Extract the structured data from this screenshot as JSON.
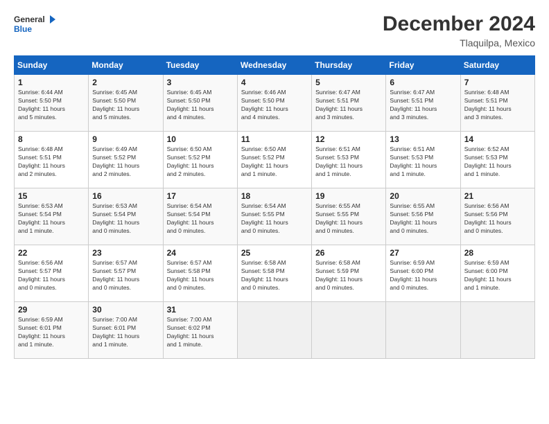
{
  "header": {
    "logo_general": "General",
    "logo_blue": "Blue",
    "month_title": "December 2024",
    "location": "Tlaquilpa, Mexico"
  },
  "calendar": {
    "days_of_week": [
      "Sunday",
      "Monday",
      "Tuesday",
      "Wednesday",
      "Thursday",
      "Friday",
      "Saturday"
    ],
    "weeks": [
      [
        {
          "day": "",
          "info": ""
        },
        {
          "day": "2",
          "info": "Sunrise: 6:45 AM\nSunset: 5:50 PM\nDaylight: 11 hours\nand 5 minutes."
        },
        {
          "day": "3",
          "info": "Sunrise: 6:45 AM\nSunset: 5:50 PM\nDaylight: 11 hours\nand 4 minutes."
        },
        {
          "day": "4",
          "info": "Sunrise: 6:46 AM\nSunset: 5:50 PM\nDaylight: 11 hours\nand 4 minutes."
        },
        {
          "day": "5",
          "info": "Sunrise: 6:47 AM\nSunset: 5:51 PM\nDaylight: 11 hours\nand 3 minutes."
        },
        {
          "day": "6",
          "info": "Sunrise: 6:47 AM\nSunset: 5:51 PM\nDaylight: 11 hours\nand 3 minutes."
        },
        {
          "day": "7",
          "info": "Sunrise: 6:48 AM\nSunset: 5:51 PM\nDaylight: 11 hours\nand 3 minutes."
        }
      ],
      [
        {
          "day": "8",
          "info": "Sunrise: 6:48 AM\nSunset: 5:51 PM\nDaylight: 11 hours\nand 2 minutes."
        },
        {
          "day": "9",
          "info": "Sunrise: 6:49 AM\nSunset: 5:52 PM\nDaylight: 11 hours\nand 2 minutes."
        },
        {
          "day": "10",
          "info": "Sunrise: 6:50 AM\nSunset: 5:52 PM\nDaylight: 11 hours\nand 2 minutes."
        },
        {
          "day": "11",
          "info": "Sunrise: 6:50 AM\nSunset: 5:52 PM\nDaylight: 11 hours\nand 1 minute."
        },
        {
          "day": "12",
          "info": "Sunrise: 6:51 AM\nSunset: 5:53 PM\nDaylight: 11 hours\nand 1 minute."
        },
        {
          "day": "13",
          "info": "Sunrise: 6:51 AM\nSunset: 5:53 PM\nDaylight: 11 hours\nand 1 minute."
        },
        {
          "day": "14",
          "info": "Sunrise: 6:52 AM\nSunset: 5:53 PM\nDaylight: 11 hours\nand 1 minute."
        }
      ],
      [
        {
          "day": "15",
          "info": "Sunrise: 6:53 AM\nSunset: 5:54 PM\nDaylight: 11 hours\nand 1 minute."
        },
        {
          "day": "16",
          "info": "Sunrise: 6:53 AM\nSunset: 5:54 PM\nDaylight: 11 hours\nand 0 minutes."
        },
        {
          "day": "17",
          "info": "Sunrise: 6:54 AM\nSunset: 5:54 PM\nDaylight: 11 hours\nand 0 minutes."
        },
        {
          "day": "18",
          "info": "Sunrise: 6:54 AM\nSunset: 5:55 PM\nDaylight: 11 hours\nand 0 minutes."
        },
        {
          "day": "19",
          "info": "Sunrise: 6:55 AM\nSunset: 5:55 PM\nDaylight: 11 hours\nand 0 minutes."
        },
        {
          "day": "20",
          "info": "Sunrise: 6:55 AM\nSunset: 5:56 PM\nDaylight: 11 hours\nand 0 minutes."
        },
        {
          "day": "21",
          "info": "Sunrise: 6:56 AM\nSunset: 5:56 PM\nDaylight: 11 hours\nand 0 minutes."
        }
      ],
      [
        {
          "day": "22",
          "info": "Sunrise: 6:56 AM\nSunset: 5:57 PM\nDaylight: 11 hours\nand 0 minutes."
        },
        {
          "day": "23",
          "info": "Sunrise: 6:57 AM\nSunset: 5:57 PM\nDaylight: 11 hours\nand 0 minutes."
        },
        {
          "day": "24",
          "info": "Sunrise: 6:57 AM\nSunset: 5:58 PM\nDaylight: 11 hours\nand 0 minutes."
        },
        {
          "day": "25",
          "info": "Sunrise: 6:58 AM\nSunset: 5:58 PM\nDaylight: 11 hours\nand 0 minutes."
        },
        {
          "day": "26",
          "info": "Sunrise: 6:58 AM\nSunset: 5:59 PM\nDaylight: 11 hours\nand 0 minutes."
        },
        {
          "day": "27",
          "info": "Sunrise: 6:59 AM\nSunset: 6:00 PM\nDaylight: 11 hours\nand 0 minutes."
        },
        {
          "day": "28",
          "info": "Sunrise: 6:59 AM\nSunset: 6:00 PM\nDaylight: 11 hours\nand 1 minute."
        }
      ],
      [
        {
          "day": "29",
          "info": "Sunrise: 6:59 AM\nSunset: 6:01 PM\nDaylight: 11 hours\nand 1 minute."
        },
        {
          "day": "30",
          "info": "Sunrise: 7:00 AM\nSunset: 6:01 PM\nDaylight: 11 hours\nand 1 minute."
        },
        {
          "day": "31",
          "info": "Sunrise: 7:00 AM\nSunset: 6:02 PM\nDaylight: 11 hours\nand 1 minute."
        },
        {
          "day": "",
          "info": ""
        },
        {
          "day": "",
          "info": ""
        },
        {
          "day": "",
          "info": ""
        },
        {
          "day": "",
          "info": ""
        }
      ]
    ],
    "first_day": {
      "day": "1",
      "info": "Sunrise: 6:44 AM\nSunset: 5:50 PM\nDaylight: 11 hours\nand 5 minutes."
    }
  }
}
